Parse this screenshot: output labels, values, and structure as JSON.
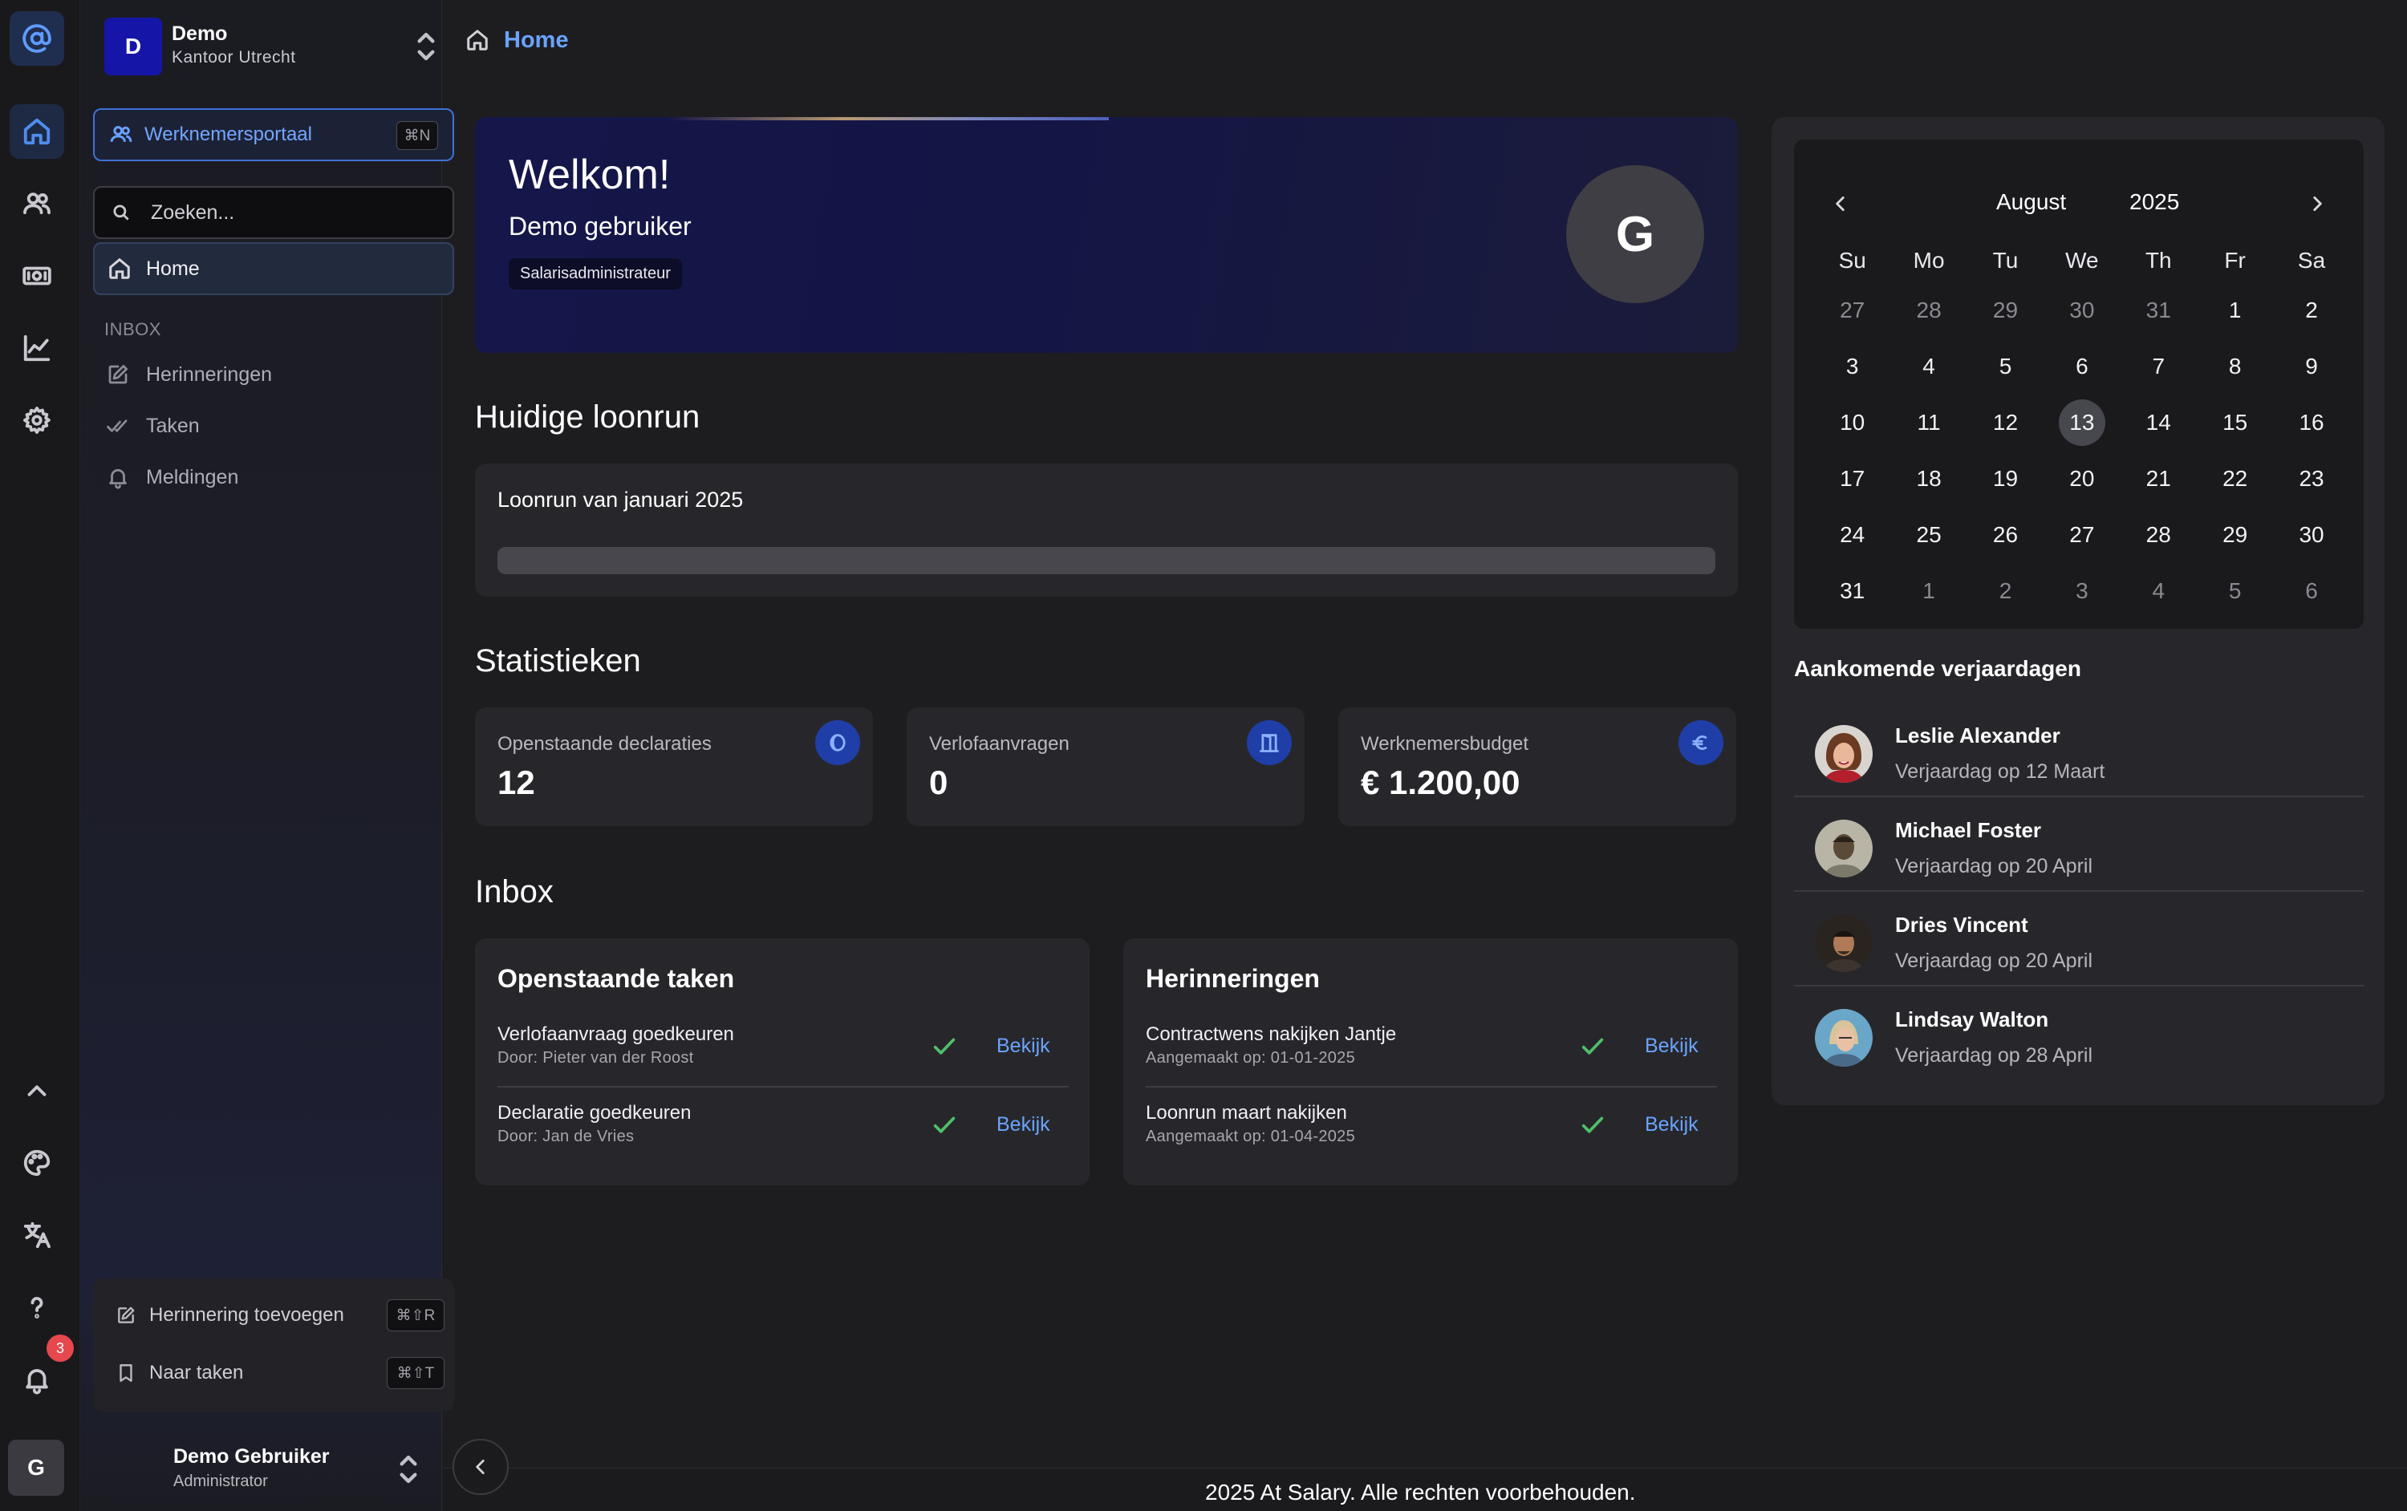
{
  "rail": {
    "icons": [
      "at-sign-icon",
      "home-icon",
      "users-icon",
      "money-icon",
      "chart-icon",
      "settings-icon",
      "chevron-up-icon",
      "palette-icon",
      "translate-icon",
      "help-icon",
      "bell-icon"
    ],
    "notification_count": "3"
  },
  "org": {
    "initial": "D",
    "name": "Demo",
    "location": "Kantoor Utrecht"
  },
  "sidebar": {
    "portal_label": "Werknemersportaal",
    "portal_shortcut": "⌘N",
    "search_placeholder": "Zoeken...",
    "home_label": "Home",
    "inbox_title": "INBOX",
    "inbox_items": [
      {
        "label": "Herinneringen",
        "icon": "edit-icon"
      },
      {
        "label": "Taken",
        "icon": "double-check-icon"
      },
      {
        "label": "Meldingen",
        "icon": "bell-icon"
      }
    ],
    "quick_actions": [
      {
        "label": "Herinnering toevoegen",
        "shortcut": "⌘⇧R",
        "icon": "edit-icon"
      },
      {
        "label": "Naar taken",
        "shortcut": "⌘⇧T",
        "icon": "bookmark-icon"
      }
    ]
  },
  "user": {
    "initial": "G",
    "name": "Demo Gebruiker",
    "role": "Administrator"
  },
  "breadcrumb": {
    "label": "Home"
  },
  "welcome": {
    "title": "Welkom!",
    "name": "Demo gebruiker",
    "role": "Salarisadministrateur",
    "avatar_initial": "G"
  },
  "payrun": {
    "section_title": "Huidige loonrun",
    "title": "Loonrun van januari 2025",
    "progress": 0
  },
  "stats": {
    "section_title": "Statistieken",
    "cards": [
      {
        "label": "Openstaande declaraties",
        "value": "12",
        "icon": "receipt-icon"
      },
      {
        "label": "Verlofaanvragen",
        "value": "0",
        "icon": "door-icon"
      },
      {
        "label": "Werknemersbudget",
        "value": "€ 1.200,00",
        "icon": "euro-icon"
      }
    ]
  },
  "inbox": {
    "section_title": "Inbox",
    "tasks": {
      "title": "Openstaande taken",
      "items": [
        {
          "title": "Verlofaanvraag goedkeuren",
          "sub": "Door: Pieter van der Roost",
          "action": "Bekijk"
        },
        {
          "title": "Declaratie goedkeuren",
          "sub": "Door: Jan de Vries",
          "action": "Bekijk"
        }
      ]
    },
    "reminders": {
      "title": "Herinneringen",
      "items": [
        {
          "title": "Contractwens nakijken Jantje",
          "sub": "Aangemaakt op: 01-01-2025",
          "action": "Bekijk"
        },
        {
          "title": "Loonrun maart nakijken",
          "sub": "Aangemaakt op: 01-04-2025",
          "action": "Bekijk"
        }
      ]
    }
  },
  "calendar": {
    "month": "August",
    "year": "2025",
    "weekdays": [
      "Su",
      "Mo",
      "Tu",
      "We",
      "Th",
      "Fr",
      "Sa"
    ],
    "days": [
      [
        "27",
        "28",
        "29",
        "30",
        "31",
        "1",
        "2"
      ],
      [
        "3",
        "4",
        "5",
        "6",
        "7",
        "8",
        "9"
      ],
      [
        "10",
        "11",
        "12",
        "13",
        "14",
        "15",
        "16"
      ],
      [
        "17",
        "18",
        "19",
        "20",
        "21",
        "22",
        "23"
      ],
      [
        "24",
        "25",
        "26",
        "27",
        "28",
        "29",
        "30"
      ],
      [
        "31",
        "1",
        "2",
        "3",
        "4",
        "5",
        "6"
      ]
    ],
    "today": "13"
  },
  "birthdays": {
    "title": "Aankomende verjaardagen",
    "items": [
      {
        "name": "Leslie Alexander",
        "date": "Verjaardag op 12 Maart"
      },
      {
        "name": "Michael Foster",
        "date": "Verjaardag op 20 April"
      },
      {
        "name": "Dries Vincent",
        "date": "Verjaardag op 20 April"
      },
      {
        "name": "Lindsay Walton",
        "date": "Verjaardag op 28 April"
      }
    ]
  },
  "footer": {
    "text": "2025 At Salary. Alle rechten voorbehouden."
  }
}
